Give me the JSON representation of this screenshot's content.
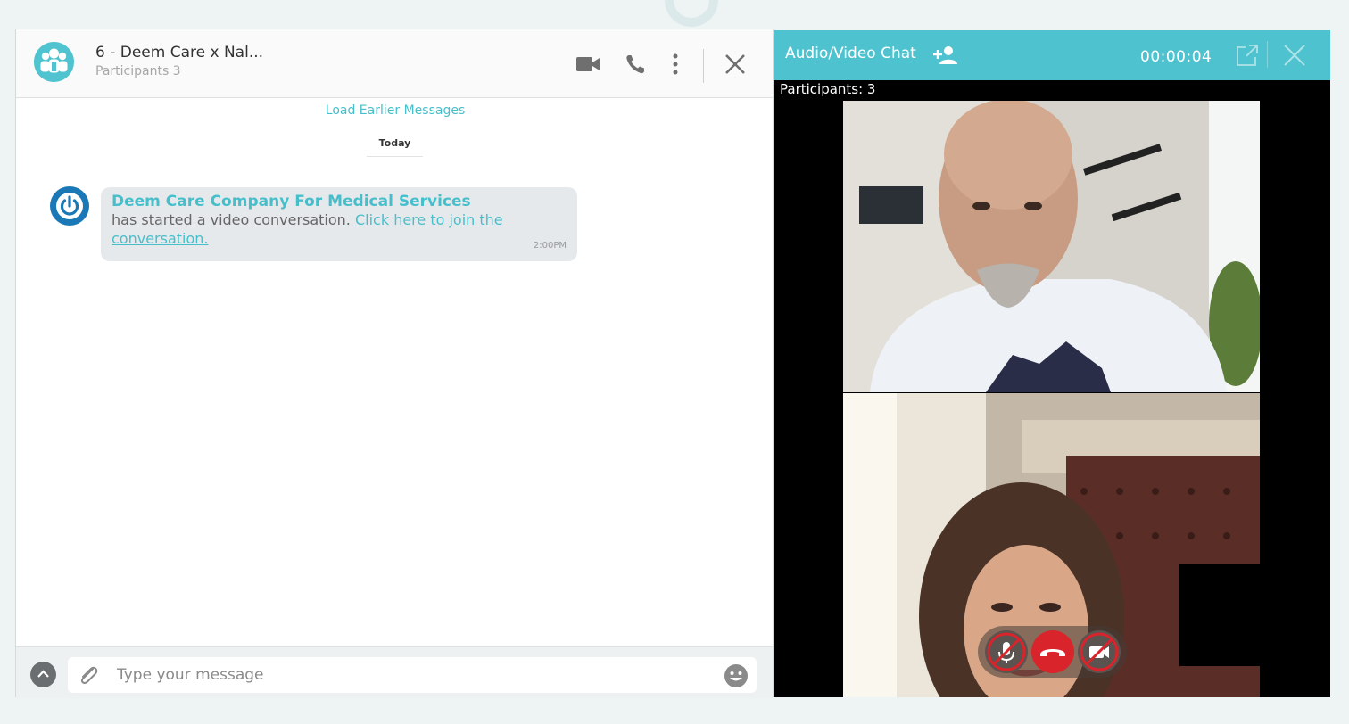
{
  "chat": {
    "title": "6 - Deem Care x Nal...",
    "subtitle": "Participants 3",
    "load_earlier": "Load Earlier Messages",
    "date_divider": "Today",
    "message": {
      "sender": "Deem Care Company For Medical Services",
      "text": "has started a video conversation.",
      "link": "Click here to join the conversation.",
      "time": "2:00PM"
    },
    "composer": {
      "placeholder": "Type your message"
    }
  },
  "video_chat": {
    "title": "Audio/Video Chat",
    "timer": "00:00:04",
    "participants": "Participants: 3"
  },
  "colors": {
    "accent": "#4ec3cf",
    "end_call": "#d8242a",
    "muted_indicator": "#d8242a"
  },
  "icons": {
    "header": [
      "video-camera-icon",
      "phone-icon",
      "more-vertical-icon",
      "close-icon"
    ],
    "video_header": [
      "add-participant-icon",
      "popout-icon",
      "close-icon"
    ],
    "controls": [
      "mic-muted-icon",
      "end-call-icon",
      "camera-off-icon"
    ]
  }
}
